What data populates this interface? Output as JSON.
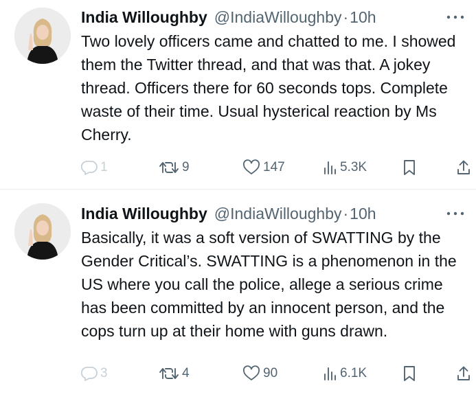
{
  "tweets": [
    {
      "author_name": "India Willoughby",
      "handle": "@IndiaWilloughby",
      "separator": "·",
      "time": "10h",
      "text": "Two lovely officers came and chatted to me. I showed them the Twitter thread, and that was that. A jokey thread. Officers there for 60 seconds tops. Complete waste of their time. Usual hysterical reaction by Ms Cherry.",
      "replies": "1",
      "retweets": "9",
      "likes": "147",
      "views": "5.3K"
    },
    {
      "author_name": "India Willoughby",
      "handle": "@IndiaWilloughby",
      "separator": "·",
      "time": "10h",
      "text": "Basically, it was a soft version of SWATTING by the Gender Critical’s. SWATTING is a phenomenon in the US where you call the police, allege a serious crime has been committed by an innocent person, and the cops turn up at their home with guns drawn.",
      "replies": "3",
      "retweets": "4",
      "likes": "90",
      "views": "6.1K"
    }
  ],
  "icons": {
    "more": "more-dots-icon",
    "reply": "reply-icon",
    "retweet": "retweet-icon",
    "like": "heart-icon",
    "views": "views-chart-icon",
    "bookmark": "bookmark-icon",
    "share": "share-icon"
  },
  "colors": {
    "text": "#0f1419",
    "secondary": "#536471",
    "faded": "#c7d0d7",
    "divider": "#e6ecf0"
  }
}
